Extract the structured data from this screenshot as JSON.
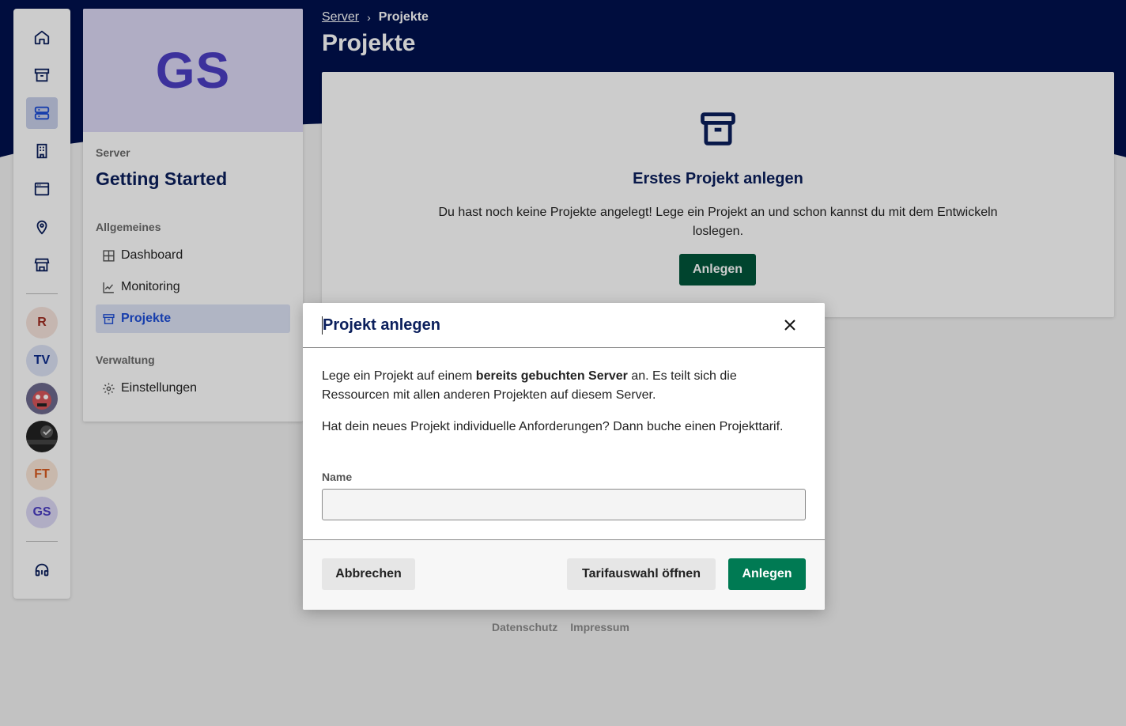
{
  "breadcrumb": {
    "parent": "Server",
    "current": "Projekte"
  },
  "page": {
    "title": "Projekte"
  },
  "rail": {
    "icons": [
      "home-icon",
      "archive-icon",
      "server-icon",
      "building-icon",
      "browser-window-icon",
      "map-pin-icon",
      "store-icon"
    ],
    "avatars": [
      {
        "initials": "R",
        "bg": "#f7e4dc",
        "fg": "#a12d22"
      },
      {
        "initials": "TV",
        "bg": "#dde3f6",
        "fg": "#0b2a8c"
      },
      {
        "initials": "",
        "bg": "#6d6a8e",
        "fg": "#ffffff"
      },
      {
        "initials": "",
        "bg": "#222222",
        "fg": "#ffffff"
      },
      {
        "initials": "FT",
        "bg": "#fbe6d8",
        "fg": "#d95a1e"
      },
      {
        "initials": "GS",
        "bg": "#ddd9f6",
        "fg": "#4b3ec4"
      }
    ],
    "support_icon": "headset-icon"
  },
  "server": {
    "initials": "GS",
    "section_label": "Server",
    "name": "Getting Started",
    "general_label": "Allgemeines",
    "nav": [
      {
        "label": "Dashboard",
        "icon": "grid-icon"
      },
      {
        "label": "Monitoring",
        "icon": "chart-icon"
      },
      {
        "label": "Projekte",
        "icon": "archive-icon"
      }
    ],
    "admin_label": "Verwaltung",
    "settings_label": "Einstellungen"
  },
  "empty_state": {
    "title": "Erstes Projekt anlegen",
    "text": "Du hast noch keine Projekte angelegt! Lege ein Projekt an und schon kannst du mit dem Entwickeln loslegen.",
    "button": "Anlegen"
  },
  "footer": {
    "privacy": "Datenschutz",
    "imprint": "Impressum"
  },
  "modal": {
    "title": "Projekt anlegen",
    "p1_before": "Lege ein Projekt auf einem ",
    "p1_bold": "bereits gebuchten Server",
    "p1_after": " an. Es teilt sich die Ressourcen mit allen anderen Projekten auf diesem Server.",
    "p2": "Hat dein neues Projekt individuelle Anforderungen? Dann buche einen Projekttarif.",
    "field_label": "Name",
    "field_value": "",
    "cancel": "Abbrechen",
    "tariff": "Tarifauswahl öffnen",
    "create": "Anlegen"
  },
  "colors": {
    "navy": "#00114e",
    "primary_green": "#007a53",
    "accent_blue": "#1d4ed8"
  }
}
